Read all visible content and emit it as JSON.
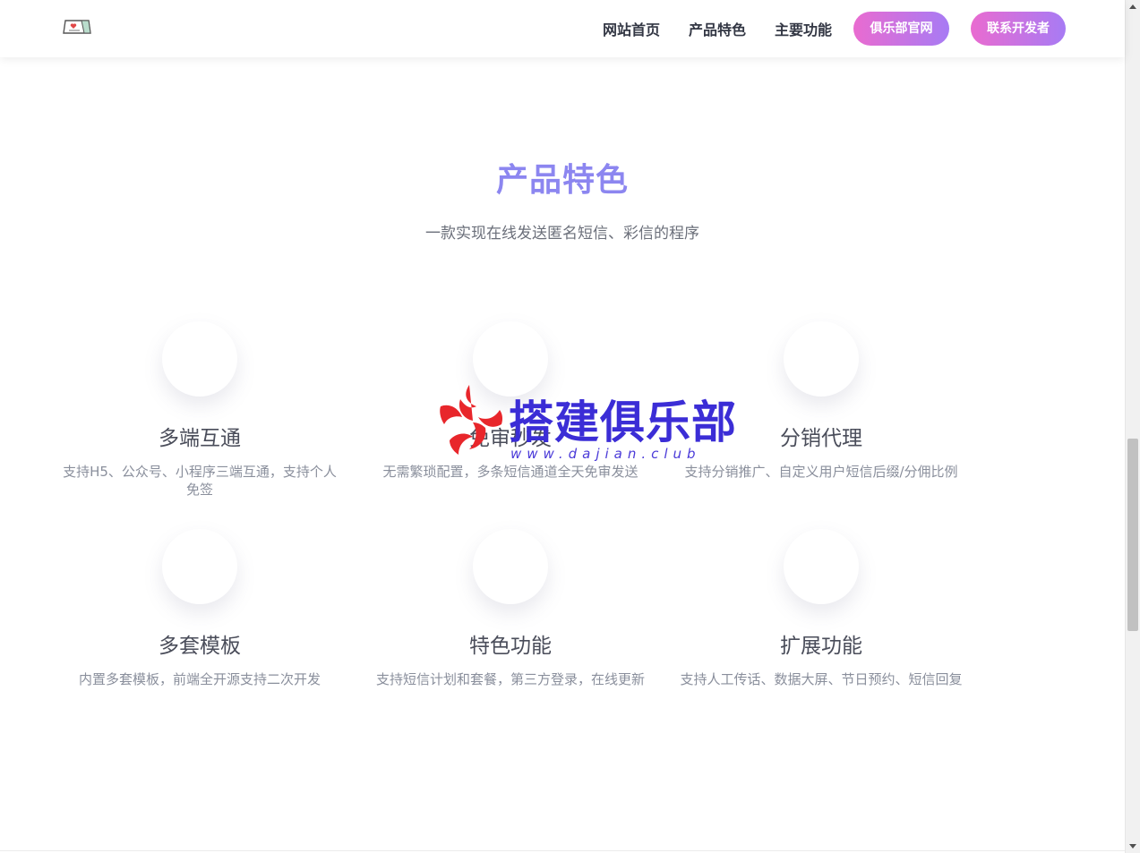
{
  "header": {
    "nav": [
      "网站首页",
      "产品特色",
      "主要功能"
    ],
    "club_button": "俱乐部官网",
    "contact_button": "联系开发者"
  },
  "colors": {
    "accent": "#8c86f0",
    "pill_gradient_start": "#e96bd0",
    "pill_gradient_end": "#a77bf4",
    "watermark_red": "#e8262b",
    "watermark_blue": "#3b2dd6"
  },
  "section": {
    "title": "产品特色",
    "subtitle": "一款实现在线发送匿名短信、彩信的程序"
  },
  "features": [
    {
      "title": "多端互通",
      "desc": "支持H5、公众号、小程序三端互通，支持个人免签"
    },
    {
      "title": "免审秒发",
      "desc": "无需繁琐配置，多条短信通道全天免审发送"
    },
    {
      "title": "分销代理",
      "desc": "支持分销推广、自定义用户短信后缀/分佣比例"
    },
    {
      "title": "多套模板",
      "desc": "内置多套模板，前端全开源支持二次开发"
    },
    {
      "title": "特色功能",
      "desc": "支持短信计划和套餐，第三方登录，在线更新"
    },
    {
      "title": "扩展功能",
      "desc": "支持人工传话、数据大屏、节日预约、短信回复"
    }
  ],
  "watermark": {
    "text": "搭建俱乐部",
    "url": "www.dajian.club"
  },
  "icons": [
    "envelope-logo-icon",
    "scroll-up-arrow-icon",
    "scroll-down-arrow-icon"
  ]
}
